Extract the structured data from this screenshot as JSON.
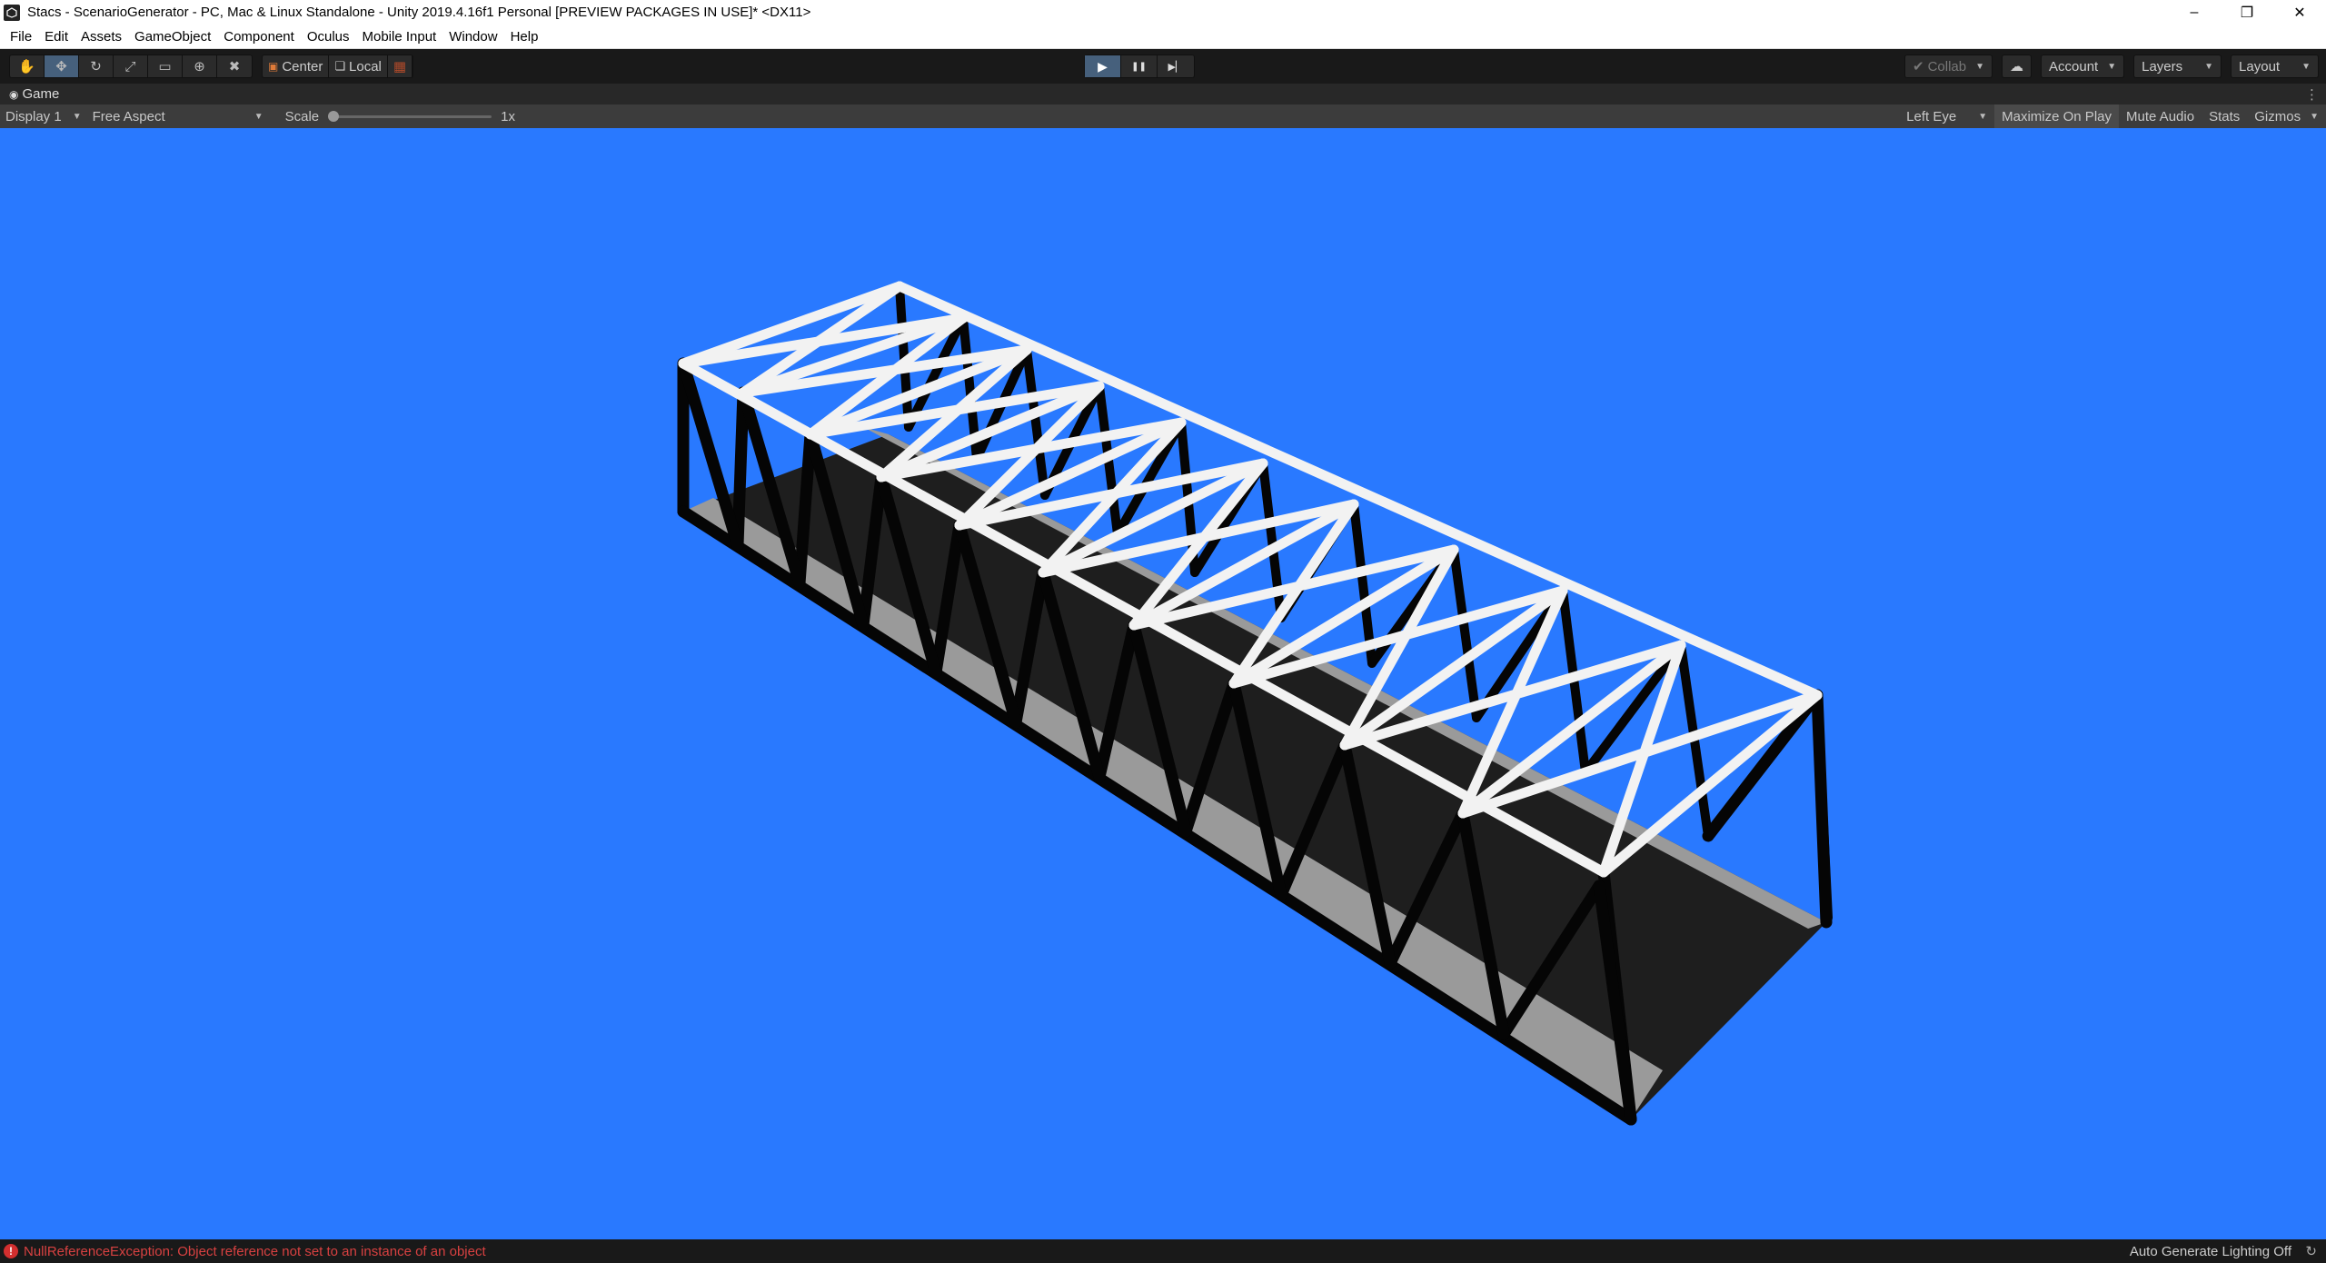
{
  "window": {
    "title": "Stacs - ScenarioGenerator - PC, Mac & Linux Standalone - Unity 2019.4.16f1 Personal [PREVIEW PACKAGES IN USE]* <DX11>",
    "minimize": "–",
    "restore": "❐",
    "close": "✕"
  },
  "menu": [
    "File",
    "Edit",
    "Assets",
    "GameObject",
    "Component",
    "Oculus",
    "Mobile Input",
    "Window",
    "Help"
  ],
  "toolbar": {
    "tools": [
      {
        "name": "hand-tool",
        "glyph": "✋"
      },
      {
        "name": "move-tool",
        "glyph": "✥"
      },
      {
        "name": "rotate-tool",
        "glyph": "↻"
      },
      {
        "name": "scale-tool",
        "glyph": "⤢"
      },
      {
        "name": "rect-tool",
        "glyph": "▭"
      },
      {
        "name": "transform-tool",
        "glyph": "⊕"
      },
      {
        "name": "custom-tool",
        "glyph": "✖"
      }
    ],
    "active_tool": 1,
    "pivot_center": "Center",
    "pivot_local": "Local",
    "play_glyph": "▶",
    "pause_glyph": "❚❚",
    "step_glyph": "▶▏",
    "collab": "Collab",
    "account": "Account",
    "layers": "Layers",
    "layout": "Layout"
  },
  "game_tab": {
    "label": "Game",
    "menu": "⋮"
  },
  "game_bar": {
    "display": "Display 1",
    "aspect": "Free Aspect",
    "scale_label": "Scale",
    "scale_value": "1x",
    "scale_fraction": 0,
    "eye": "Left Eye",
    "maximize": "Maximize On Play",
    "mute": "Mute Audio",
    "stats": "Stats",
    "gizmos": "Gizmos"
  },
  "colors": {
    "viewport_bg": "#2979ff",
    "truss_light": "#f2f2f2",
    "truss_dark": "#050505",
    "deck": "#1e1e1e",
    "deck_edge": "#9a9a9a"
  },
  "status": {
    "error_icon": "!",
    "error": "NullReferenceException: Object reference not set to an instance of an object",
    "right": "Auto Generate Lighting Off"
  }
}
